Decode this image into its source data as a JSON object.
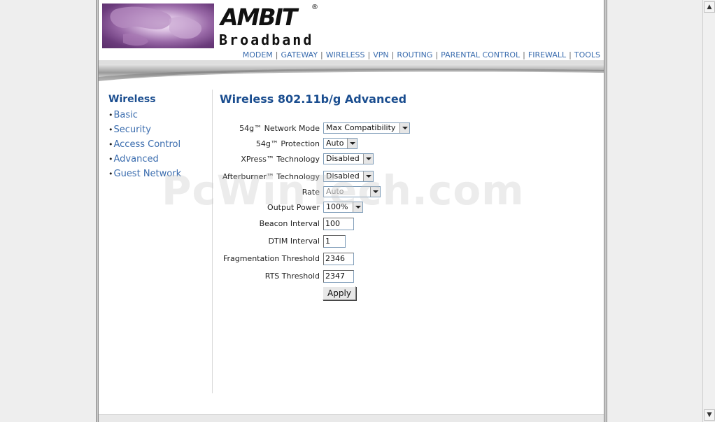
{
  "brand": {
    "name": "AMBIT",
    "reg": "®",
    "sub": "Broadband"
  },
  "topnav": [
    "MODEM",
    "GATEWAY",
    "WIRELESS",
    "VPN",
    "ROUTING",
    "PARENTAL CONTROL",
    "FIREWALL",
    "TOOLS"
  ],
  "leftnav": {
    "title": "Wireless",
    "items": [
      "Basic",
      "Security",
      "Access Control",
      "Advanced",
      "Guest Network"
    ]
  },
  "content": {
    "title": "Wireless 802.11b/g Advanced",
    "fields": {
      "network_mode": {
        "label": "54g™ Network Mode",
        "value": "Max Compatibility"
      },
      "protection": {
        "label": "54g™ Protection",
        "value": "Auto"
      },
      "xpress": {
        "label": "XPress™ Technology",
        "value": "Disabled"
      },
      "afterburner": {
        "label": "Afterburner™ Technology",
        "value": "Disabled"
      },
      "rate": {
        "label": "Rate",
        "value": "Auto"
      },
      "output_power": {
        "label": "Output Power",
        "value": "100%"
      },
      "beacon": {
        "label": "Beacon Interval",
        "value": "100"
      },
      "dtim": {
        "label": "DTIM Interval",
        "value": "1"
      },
      "frag": {
        "label": "Fragmentation Threshold",
        "value": "2346"
      },
      "rts": {
        "label": "RTS Threshold",
        "value": "2347"
      }
    },
    "apply_label": "Apply"
  },
  "watermark": "PcWinTech.com",
  "colors": {
    "link": "#3a6cae",
    "heading": "#1a4d8f"
  }
}
